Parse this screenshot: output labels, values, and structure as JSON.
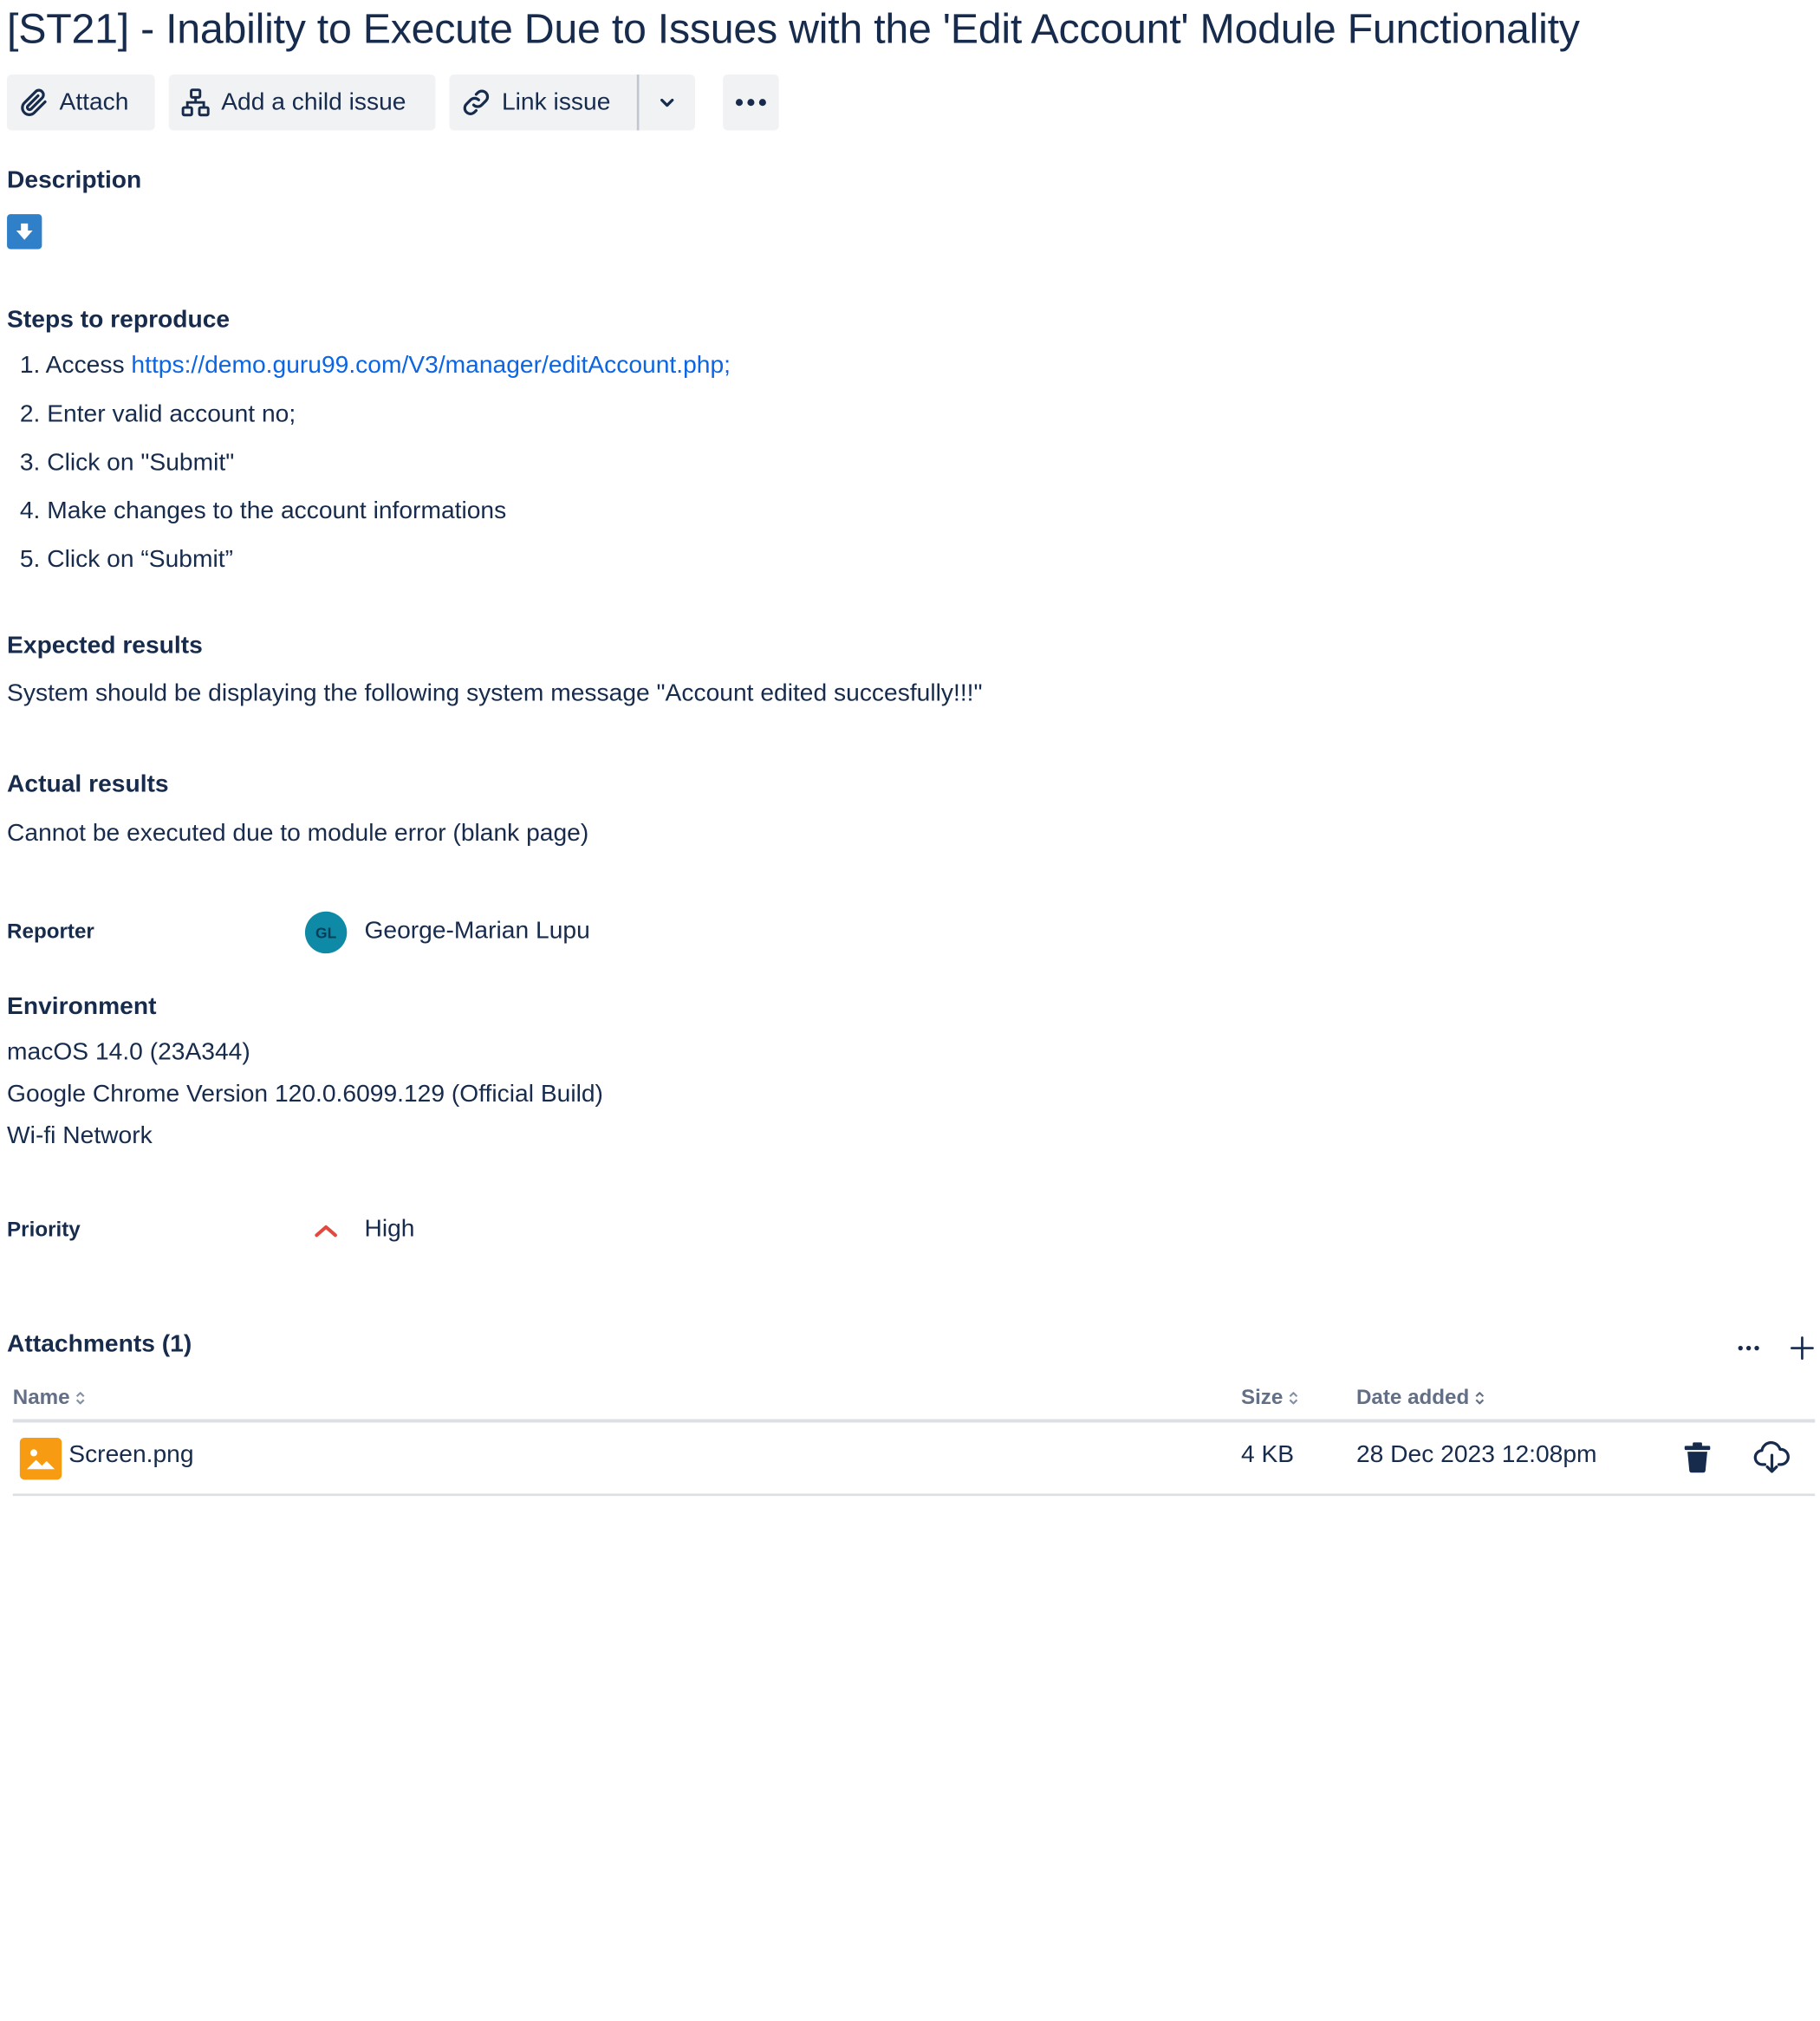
{
  "issue": {
    "title": "[ST21] - Inability to Execute Due to Issues with the 'Edit Account' Module Functionality"
  },
  "toolbar": {
    "attach": "Attach",
    "add_child": "Add a child issue",
    "link_issue": "Link issue"
  },
  "description": {
    "heading": "Description",
    "steps_heading": "Steps to reproduce",
    "steps": [
      {
        "num": "1.",
        "prefix": "Access ",
        "link": "https://demo.guru99.com/V3/manager/editAccount.php;"
      },
      {
        "num": "2.",
        "text": "Enter valid account no;"
      },
      {
        "num": "3.",
        "text": "Click on \"Submit\""
      },
      {
        "num": "4.",
        "text": "Make changes to the account informations"
      },
      {
        "num": "5.",
        "text": "Click on “Submit”"
      }
    ],
    "expected_heading": "Expected results",
    "expected_text": "System should be displaying the following system message \"Account edited succesfully!!!\"",
    "actual_heading": "Actual results",
    "actual_text": "Cannot be executed due to module error (blank page)"
  },
  "reporter": {
    "label": "Reporter",
    "initials": "GL",
    "name": "George-Marian Lupu"
  },
  "environment": {
    "heading": "Environment",
    "lines": [
      "macOS 14.0 (23A344)",
      "Google Chrome Version 120.0.6099.129 (Official Build)",
      "Wi-fi Network"
    ]
  },
  "priority": {
    "label": "Priority",
    "value": "High",
    "color": "#e2483d"
  },
  "attachments": {
    "heading": "Attachments (1)",
    "columns": {
      "name": "Name",
      "size": "Size",
      "date": "Date added"
    },
    "rows": [
      {
        "name": "Screen.png",
        "size": "4 KB",
        "date": "28 Dec 2023 12:08pm",
        "icon": "image-file-icon"
      }
    ]
  },
  "colors": {
    "text": "#172b4d",
    "link": "#0c66e4",
    "button_bg": "#f1f2f4",
    "avatar": "#0e8aa6",
    "file_icon": "#f79b12",
    "download_badge": "#2f80c8"
  }
}
